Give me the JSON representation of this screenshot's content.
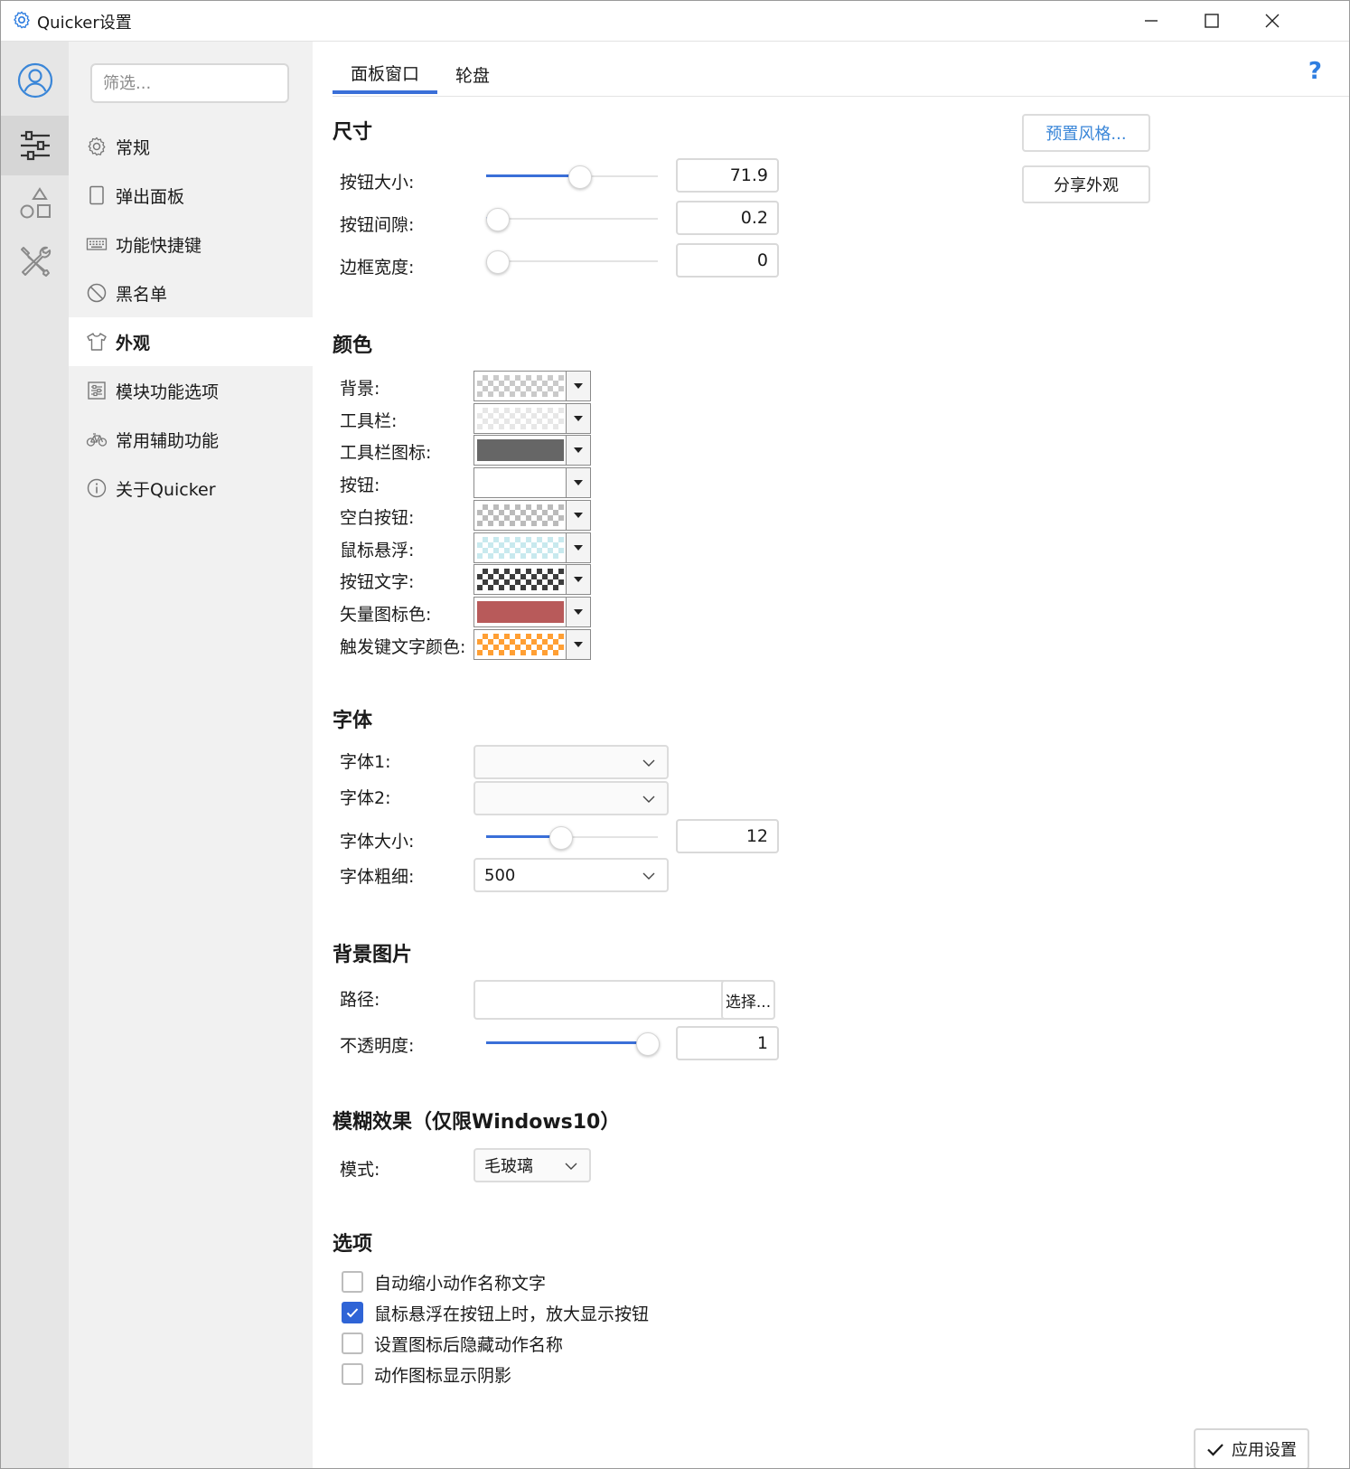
{
  "window": {
    "title": "Quicker设置",
    "app_icon": "gear-icon",
    "controls": [
      "minimize-icon",
      "maximize-icon",
      "close-icon"
    ]
  },
  "rail": {
    "items": [
      {
        "icon": "user-avatar-icon",
        "active": false
      },
      {
        "icon": "sliders-icon",
        "active": true
      },
      {
        "icon": "shapes-icon",
        "active": false
      },
      {
        "icon": "tools-icon",
        "active": false
      }
    ],
    "accent": "#3a86d8"
  },
  "nav": {
    "filter_placeholder": "筛选...",
    "items": [
      {
        "label": "常规",
        "icon": "gear-icon"
      },
      {
        "label": "弹出面板",
        "icon": "panel-icon"
      },
      {
        "label": "功能快捷键",
        "icon": "keyboard-icon"
      },
      {
        "label": "黑名单",
        "icon": "block-icon"
      },
      {
        "label": "外观",
        "icon": "tshirt-icon",
        "active": true
      },
      {
        "label": "模块功能选项",
        "icon": "module-icon"
      },
      {
        "label": "常用辅助功能",
        "icon": "bicycle-icon"
      },
      {
        "label": "关于Quicker",
        "icon": "info-icon"
      }
    ]
  },
  "tabs": [
    {
      "label": "面板窗口",
      "active": true
    },
    {
      "label": "轮盘",
      "active": false
    }
  ],
  "help_label": "?",
  "side_buttons": {
    "preset": "预置风格...",
    "share": "分享外观"
  },
  "size": {
    "title": "尺寸",
    "rows": [
      {
        "label": "按钮大小:",
        "value": "71.9",
        "level": 0.54
      },
      {
        "label": "按钮间隙:",
        "value": "0.2",
        "level": 0.06
      },
      {
        "label": "边框宽度:",
        "value": "0",
        "level": 0.0
      }
    ]
  },
  "colors": {
    "title": "颜色",
    "rows": [
      {
        "label": "背景:",
        "color": "#c8c8c8",
        "checker": true
      },
      {
        "label": "工具栏:",
        "color": "#e6e6e6",
        "checker": true
      },
      {
        "label": "工具栏图标:",
        "color": "#666666",
        "checker": false
      },
      {
        "label": "按钮:",
        "color": "#ffffff",
        "checker": false
      },
      {
        "label": "空白按钮:",
        "color": "#b8b8b8",
        "checker": true
      },
      {
        "label": "鼠标悬浮:",
        "color": "#c6e8ee",
        "checker": true
      },
      {
        "label": "按钮文字:",
        "color": "#333333",
        "checker": true
      },
      {
        "label": "矢量图标色:",
        "color": "#b85a5a",
        "checker": false
      },
      {
        "label": "触发键文字颜色:",
        "color": "#ff9a2a",
        "checker": true
      }
    ]
  },
  "font": {
    "title": "字体",
    "font1_label": "字体1:",
    "font1_value": "",
    "font2_label": "字体2:",
    "font2_value": "",
    "size_label": "字体大小:",
    "size_value": "12",
    "size_level": 0.43,
    "weight_label": "字体粗细:",
    "weight_value": "500"
  },
  "bg_image": {
    "title": "背景图片",
    "path_label": "路径:",
    "path_value": "",
    "choose": "选择...",
    "opacity_label": "不透明度:",
    "opacity_value": "1",
    "opacity_level": 1.0
  },
  "blur": {
    "title": "模糊效果（仅限Windows10）",
    "mode_label": "模式:",
    "mode_value": "毛玻璃"
  },
  "options": {
    "title": "选项",
    "items": [
      {
        "label": "自动缩小动作名称文字",
        "checked": false
      },
      {
        "label": "鼠标悬浮在按钮上时，放大显示按钮",
        "checked": true
      },
      {
        "label": "设置图标后隐藏动作名称",
        "checked": false
      },
      {
        "label": "动作图标显示阴影",
        "checked": false
      }
    ]
  },
  "apply_label": "应用设置"
}
